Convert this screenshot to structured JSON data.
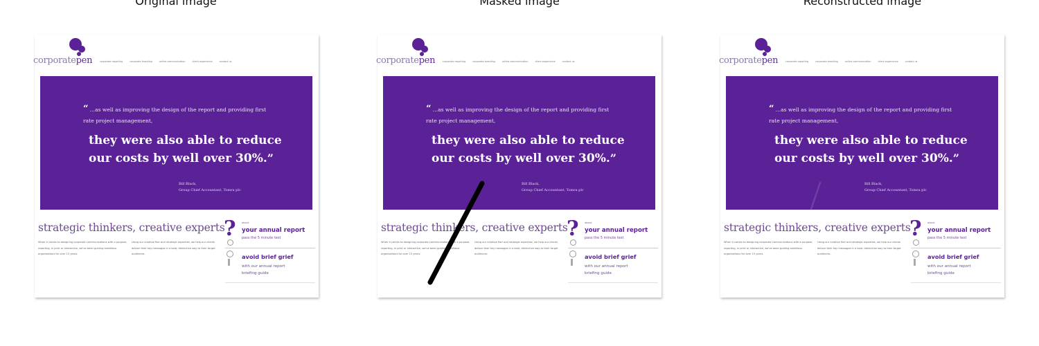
{
  "panels": [
    {
      "title": "Original image",
      "mask": "none"
    },
    {
      "title": "Masked image",
      "mask": "solid"
    },
    {
      "title": "Reconstructed image",
      "mask": "faint"
    }
  ],
  "colors": {
    "brand_purple": "#5b2196",
    "mask_black": "#000000"
  },
  "site": {
    "logo_text_prefix": "corporate",
    "logo_text_suffix": "pen",
    "nav_items": [
      "corporate reporting",
      "corporate branding",
      "online communication",
      "client experience",
      "contact us"
    ],
    "hero": {
      "quote_intro": "…as well as improving the design of the report and providing first rate project management,",
      "quote_main": "they were also able to reduce our costs by well over 30%.",
      "attribution_name": "Bill Black,",
      "attribution_role": "Group Chief Accountant, Tomra plc"
    },
    "strapline": "strategic thinkers, creative experts",
    "body_col1": "When it comes to designing corporate communications with a purpose, reporting, in print or interactive, we've been guiding ambitious organisations for over 15 years.",
    "body_col2": "Using our creative flair and strategic expertise, we help our clients deliver their key messages in a bold, distinctive way to their target audiences.",
    "sidebar": {
      "small_label": "about",
      "headline1": "your annual report",
      "sub1": "pass the 5 minute test",
      "headline2": "avoid brief grief",
      "sub2_line1": "with our annual report",
      "sub2_line2": "briefing guide"
    }
  }
}
